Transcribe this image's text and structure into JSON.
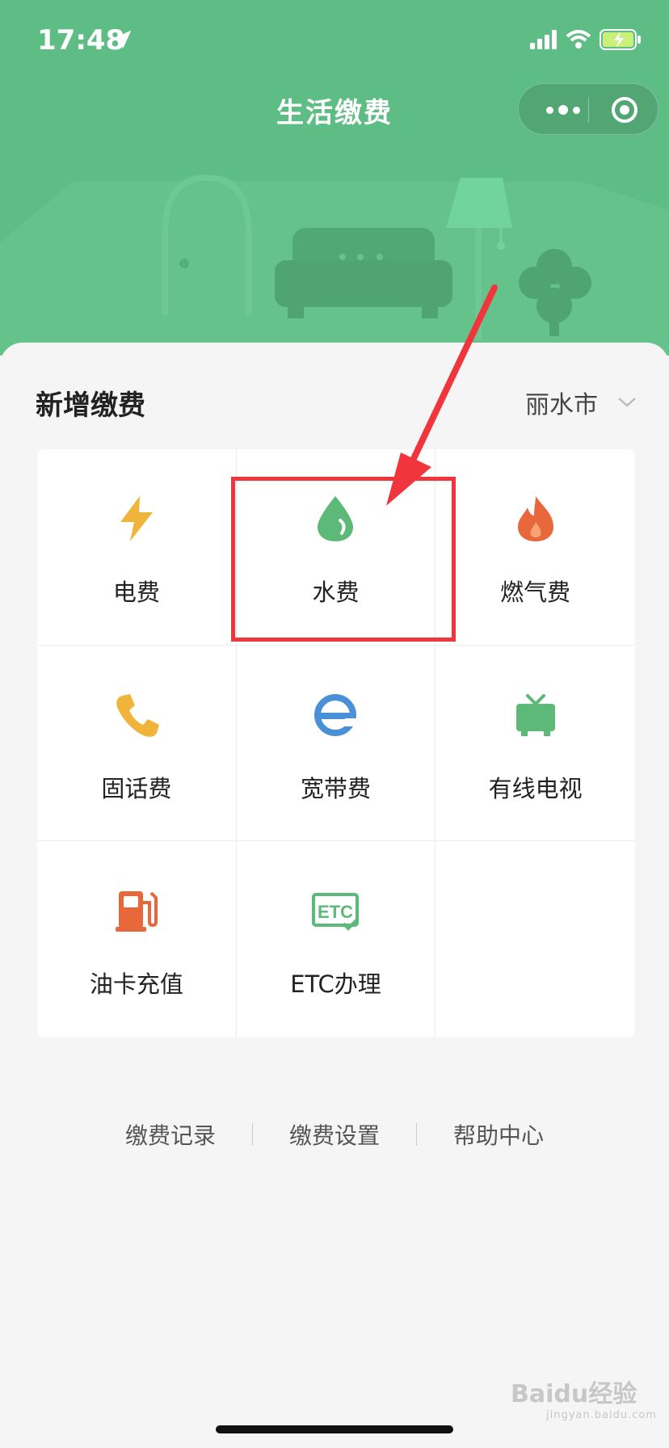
{
  "status": {
    "time": "17:48"
  },
  "nav": {
    "title": "生活缴费"
  },
  "section": {
    "title": "新增缴费",
    "city": "丽水市"
  },
  "services": [
    {
      "label": "电费",
      "icon": "lightning-icon",
      "color": "#f0b43a"
    },
    {
      "label": "水费",
      "icon": "water-drop-icon",
      "color": "#5db978"
    },
    {
      "label": "燃气费",
      "icon": "flame-icon",
      "color": "#e8683b"
    },
    {
      "label": "固话费",
      "icon": "phone-icon",
      "color": "#f0b43a"
    },
    {
      "label": "宽带费",
      "icon": "broadband-e-icon",
      "color": "#4a90d9"
    },
    {
      "label": "有线电视",
      "icon": "tv-icon",
      "color": "#5db978"
    },
    {
      "label": "油卡充值",
      "icon": "fuel-pump-icon",
      "color": "#e8683b"
    },
    {
      "label": "ETC办理",
      "icon": "etc-icon",
      "color": "#5db978"
    }
  ],
  "footer": {
    "links": [
      "缴费记录",
      "缴费设置",
      "帮助中心"
    ]
  },
  "watermark": {
    "brand": "Baidu经验",
    "url": "jingyan.baidu.com"
  },
  "colors": {
    "header": "#5ebd84",
    "highlight": "#f0353d"
  }
}
